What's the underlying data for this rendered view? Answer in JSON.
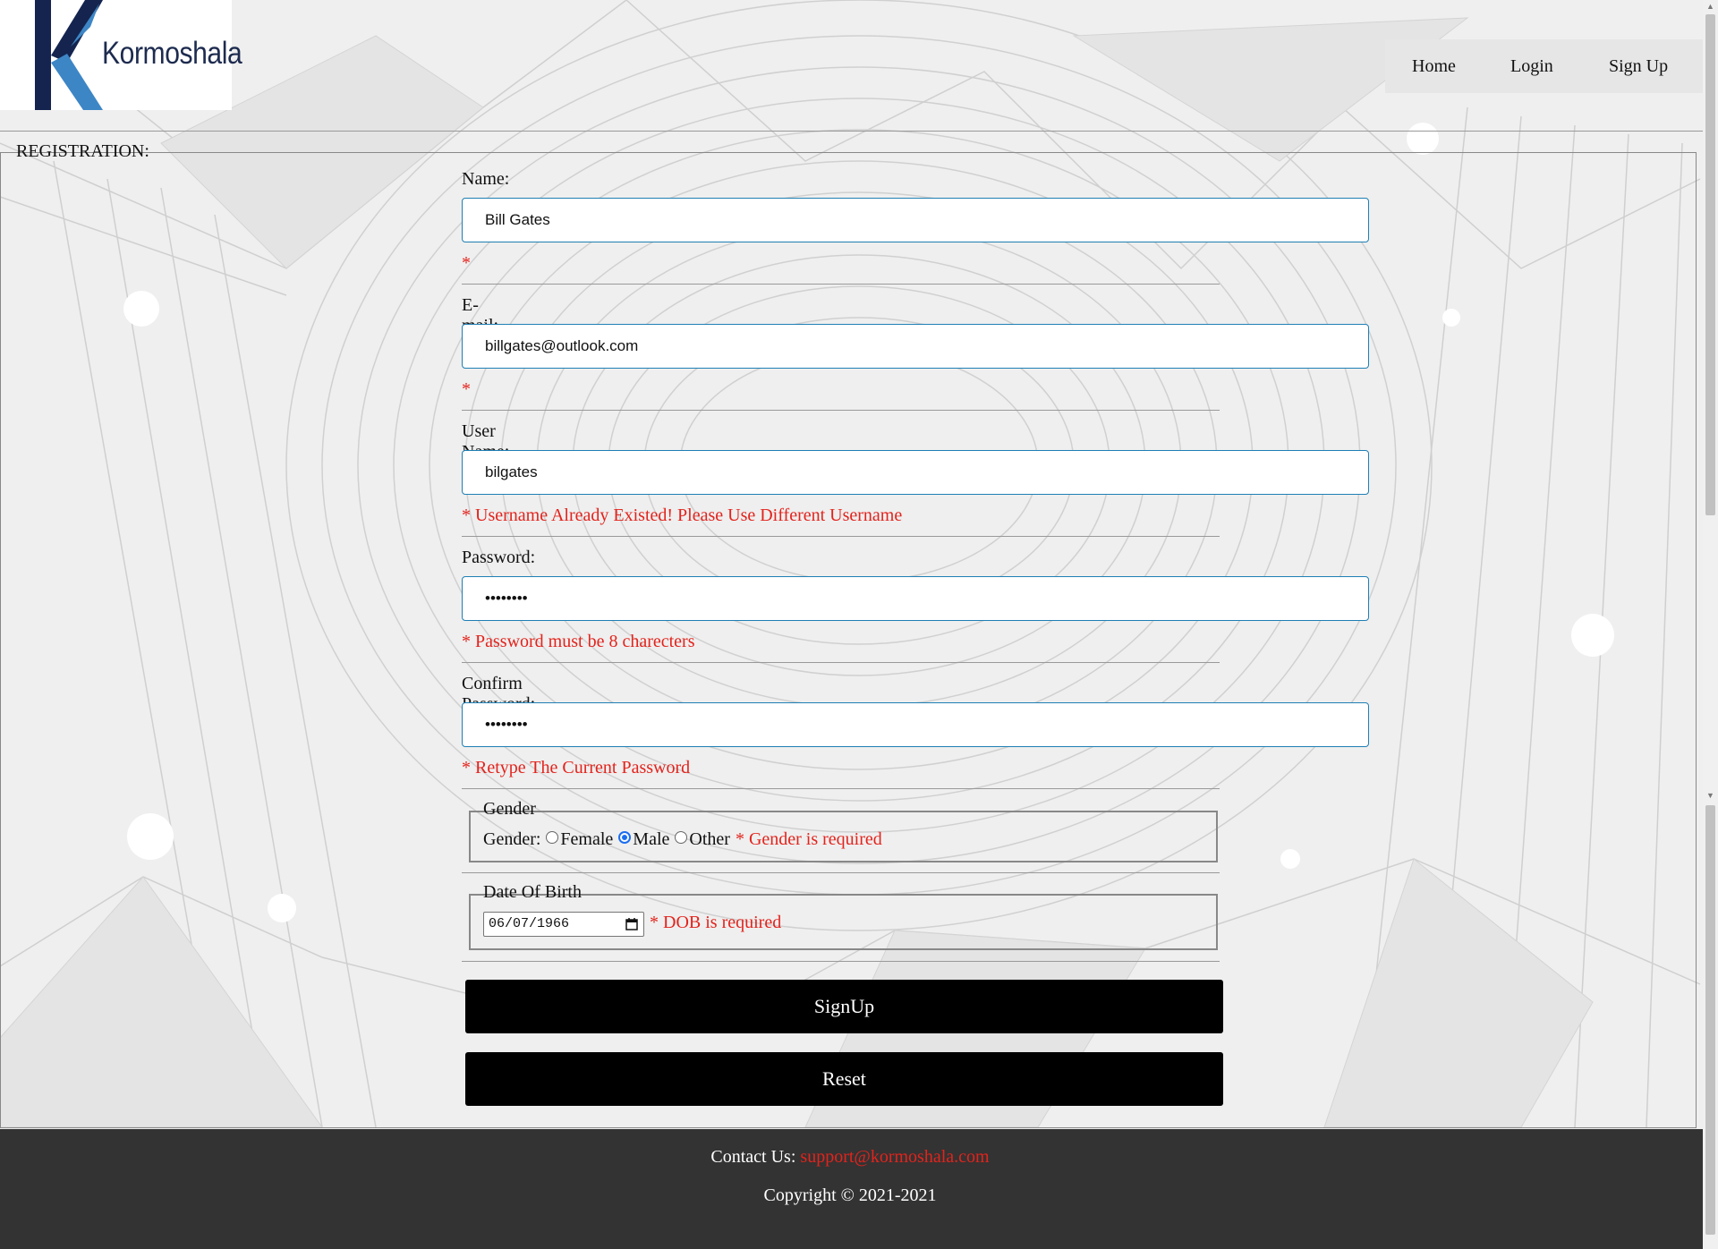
{
  "brand": {
    "name": "Kormoshala"
  },
  "nav": {
    "items": [
      "Home",
      "Login",
      "Sign Up"
    ]
  },
  "form": {
    "legend": "REGISTRATION:",
    "name": {
      "label": "Name:",
      "value": "Bill Gates",
      "error": "*"
    },
    "email": {
      "label": "E-mail:",
      "value": "billgates@outlook.com",
      "error": "*"
    },
    "username": {
      "label": "User Name:",
      "value": "bilgates",
      "error": "* Username Already Existed! Please Use Different Username"
    },
    "password": {
      "label": "Password:",
      "value": "••••••••",
      "error": "* Password must be 8 charecters"
    },
    "confirm": {
      "label": "Confirm Password:",
      "value": "••••••••",
      "error": "* Retype The Current Password"
    },
    "gender": {
      "legend": "Gender",
      "label": "Gender:",
      "options": [
        "Female",
        "Male",
        "Other"
      ],
      "selected": "Male",
      "error": "* Gender is required"
    },
    "dob": {
      "legend": "Date Of Birth",
      "value": "06/07/1966",
      "error": "* DOB is required"
    },
    "signup_label": "SignUp",
    "reset_label": "Reset"
  },
  "footer": {
    "contact_label": "Contact Us:",
    "contact_email": "support@kormoshala.com",
    "copyright": "Copyright © 2021-2021"
  },
  "colors": {
    "accent_blue": "#1e7fb4",
    "error_red": "#e3231c",
    "footer_bg": "#333333",
    "button_bg": "#000000"
  },
  "icons": [
    "kormoshala-logo-icon",
    "calendar-icon"
  ]
}
